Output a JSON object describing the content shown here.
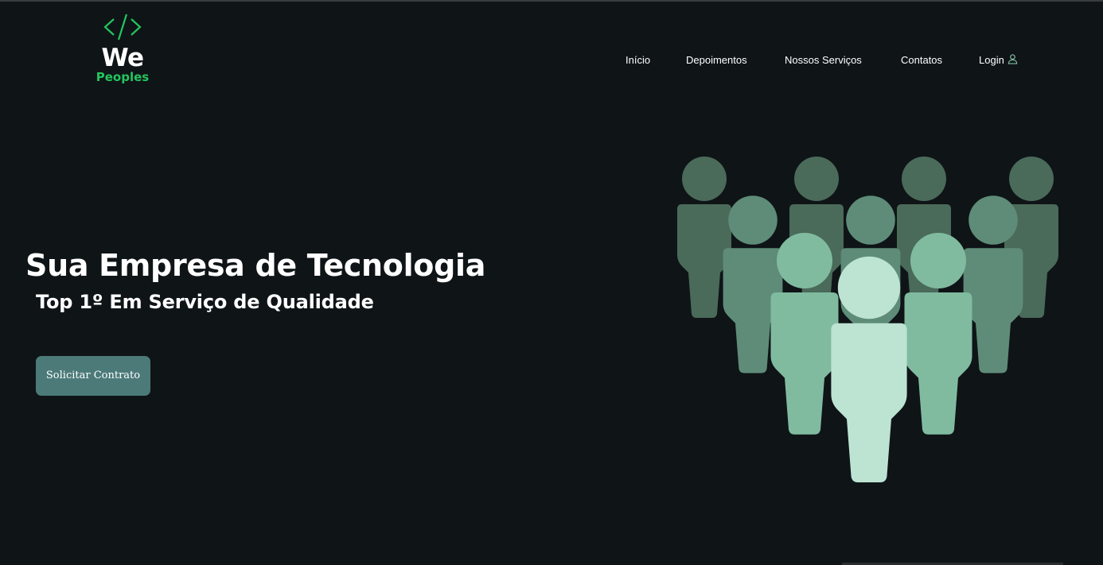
{
  "brand": {
    "name_top": "We",
    "name_bottom": "Peoples",
    "icon": "code-brackets-icon",
    "accent_color": "#22c55e"
  },
  "nav": {
    "items": [
      {
        "label": "Início"
      },
      {
        "label": "Depoimentos"
      },
      {
        "label": "Nossos Serviços"
      },
      {
        "label": "Contatos"
      }
    ],
    "login": {
      "label": "Login",
      "icon": "user-icon"
    }
  },
  "hero": {
    "title": "Sua Empresa de Tecnologia",
    "subtitle": "Top 1º Em Serviço de Qualidade",
    "cta_label": "Solicitar Contrato",
    "cta_color": "#4b7a79"
  },
  "illustration": {
    "icon": "group-of-people-icon",
    "colors": [
      "#4a6a5a",
      "#5e8c78",
      "#80bba0",
      "#bde3d3"
    ]
  },
  "colors": {
    "background": "#0f1417",
    "text": "#ffffff"
  }
}
